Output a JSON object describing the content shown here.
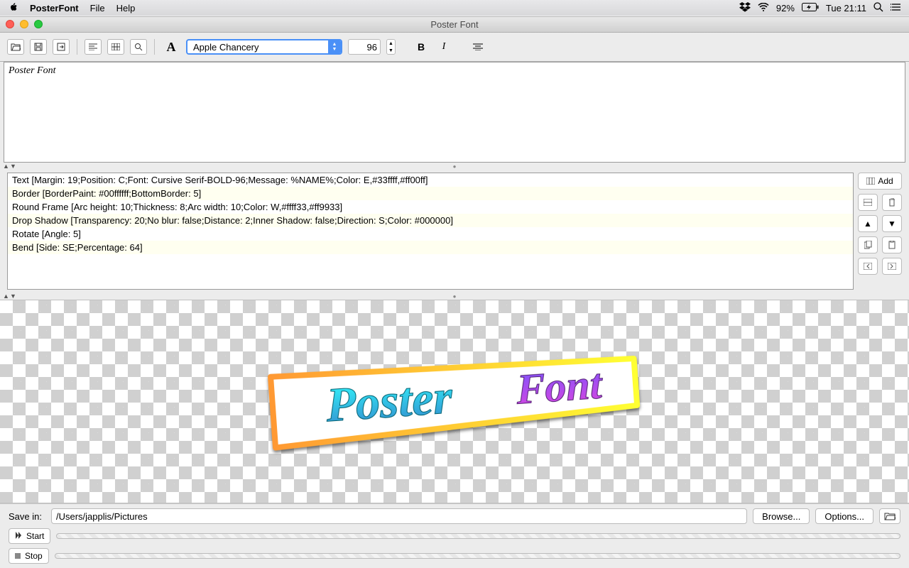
{
  "menubar": {
    "appname": "PosterFont",
    "items": [
      "File",
      "Help"
    ],
    "battery": "92%",
    "clock": "Tue 21:11"
  },
  "window": {
    "title": "Poster Font"
  },
  "toolbar": {
    "font_letter": "A",
    "font_name": "Apple Chancery",
    "font_size": "96",
    "bold": "B",
    "italic": "I"
  },
  "text_input": "Poster Font",
  "filters": [
    "Text [Margin: 19;Position: C;Font: Cursive Serif-BOLD-96;Message: %NAME%;Color: E,#33ffff,#ff00ff]",
    "Border [BorderPaint: #00ffffff;BottomBorder: 5]",
    "Round Frame [Arc height: 10;Thickness: 8;Arc width: 10;Color: W,#ffff33,#ff9933]",
    "Drop Shadow [Transparency: 20;No blur: false;Distance: 2;Inner Shadow: false;Direction: S;Color: #000000]",
    "Rotate [Angle: 5]",
    "Bend [Side: SE;Percentage: 64]"
  ],
  "side": {
    "add": "Add"
  },
  "preview": {
    "word1": "Poster",
    "word2": "Font"
  },
  "bottom": {
    "save_label": "Save in:",
    "path": "/Users/japplis/Pictures",
    "browse": "Browse...",
    "options": "Options...",
    "start": "Start",
    "stop": "Stop"
  }
}
